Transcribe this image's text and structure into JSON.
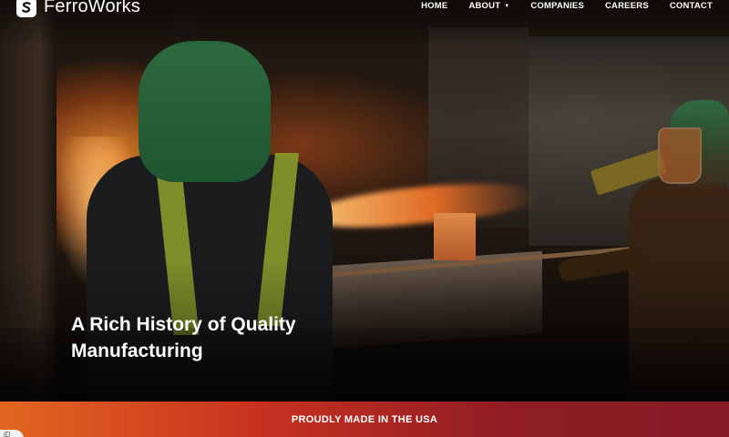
{
  "brand": {
    "name": "FerroWorks",
    "logo_icon": "logo-s-icon"
  },
  "nav": {
    "items": [
      {
        "label": "HOME"
      },
      {
        "label": "ABOUT",
        "has_dropdown": true,
        "dropdown_icon": "caret-down-icon"
      },
      {
        "label": "COMPANIES"
      },
      {
        "label": "CAREERS"
      },
      {
        "label": "CONTACT"
      }
    ]
  },
  "hero": {
    "headline": "A Rich History of Quality Manufacturing"
  },
  "banner": {
    "text": "PROUDLY MADE IN THE USA",
    "gradient_colors": [
      "#e2661f",
      "#c8321f",
      "#851a26"
    ]
  },
  "corner_badge": {
    "text": "iD"
  }
}
